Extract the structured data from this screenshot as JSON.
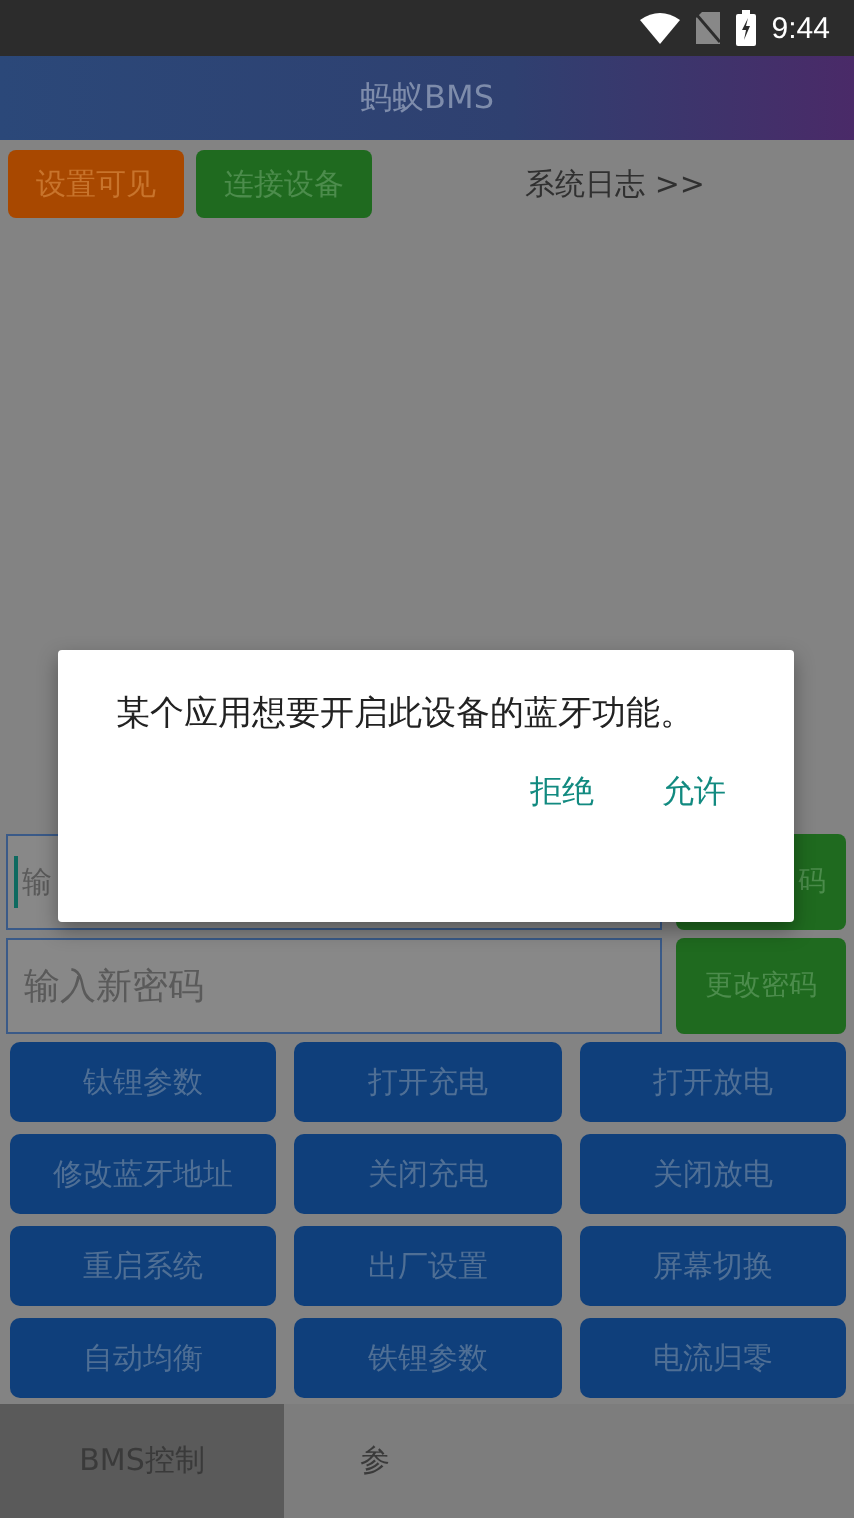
{
  "status_bar": {
    "time": "9:44"
  },
  "app_bar": {
    "title": "蚂蚁BMS"
  },
  "toolbar": {
    "buttons": [
      {
        "label": "设置可见",
        "color": "#a84800"
      },
      {
        "label": "连接设备",
        "color": "#1f6a1f"
      }
    ],
    "log_link": "系统日志 >>"
  },
  "password_row": {
    "placeholder": "输",
    "button": "码"
  },
  "new_password_row": {
    "placeholder": "输入新密码",
    "button": "更改密码"
  },
  "function_buttons": [
    "钛锂参数",
    "打开充电",
    "打开放电",
    "修改蓝牙地址",
    "关闭充电",
    "关闭放电",
    "重启系统",
    "出厂设置",
    "屏幕切换",
    "自动均衡",
    "铁锂参数",
    "电流归零"
  ],
  "bottom_tabs": [
    {
      "label": "BMS控制",
      "selected": true
    },
    {
      "label": "参",
      "selected": false
    }
  ],
  "dialog": {
    "message": "某个应用想要开启此设备的蓝牙功能。",
    "buttons": [
      "拒绝",
      "允许"
    ]
  }
}
